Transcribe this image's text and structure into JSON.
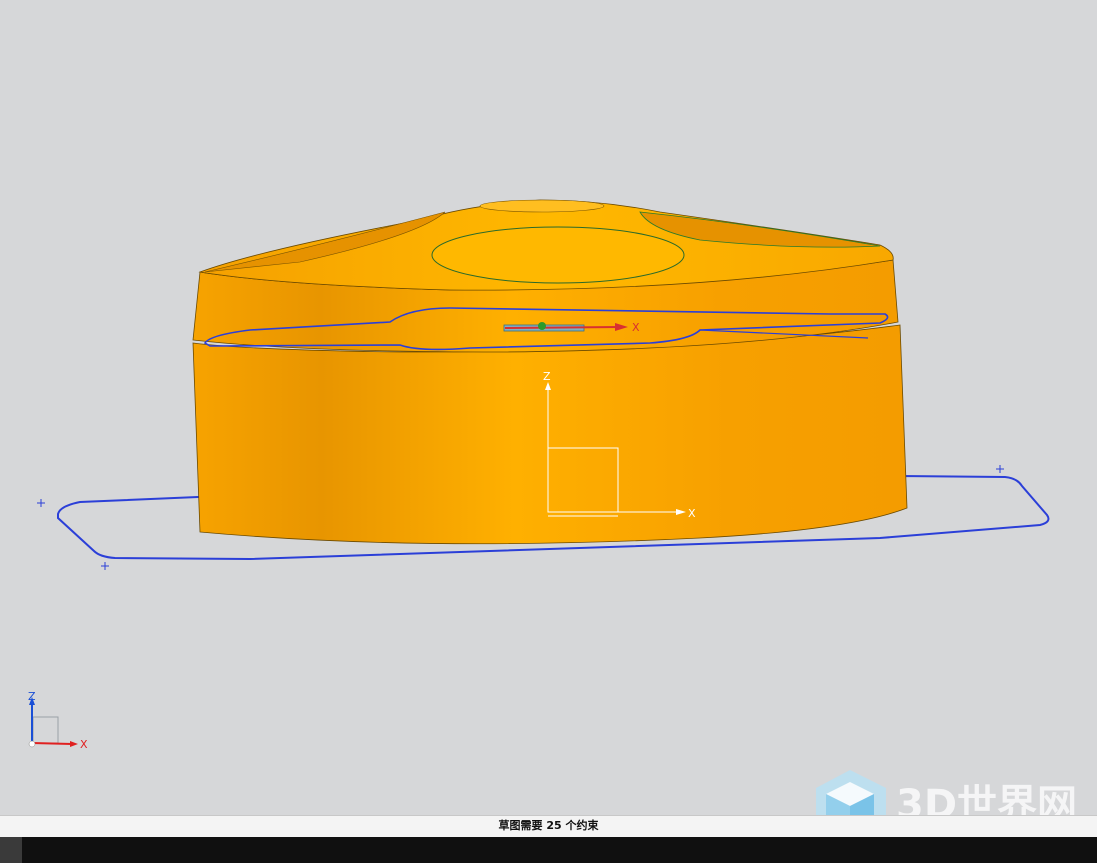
{
  "status": {
    "message": "草图需要 25 个约束"
  },
  "triad_center": {
    "x_label": "X",
    "z_label": "Z"
  },
  "triad_corner": {
    "x_label": "X",
    "z_label": "Z"
  },
  "sketch_axis": {
    "x_label": "X"
  },
  "watermark": {
    "text": "3D世界网"
  },
  "colors": {
    "background": "#d6d7d9",
    "body": "#f7a000",
    "sketch_curve": "#2b3fd8",
    "x_axis": "#e02020",
    "z_axis": "#1a4fd6"
  }
}
